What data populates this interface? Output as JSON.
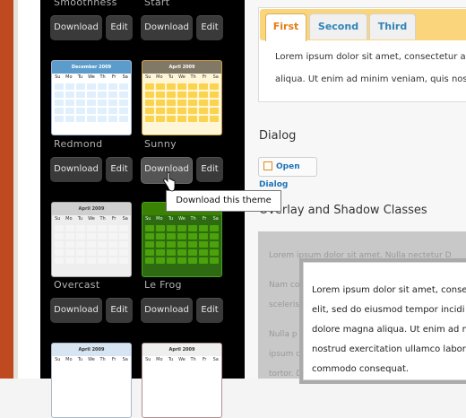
{
  "gallery": {
    "themes": [
      {
        "name": "Smoothness",
        "download_label": "Download",
        "edit_label": "Edit"
      },
      {
        "name": "Start",
        "download_label": "Download",
        "edit_label": "Edit"
      },
      {
        "name": "Redmond",
        "download_label": "Download",
        "edit_label": "Edit",
        "thumb_title": "December 2009"
      },
      {
        "name": "Sunny",
        "download_label": "Download",
        "edit_label": "Edit",
        "thumb_title": "April 2009"
      },
      {
        "name": "Overcast",
        "download_label": "Download",
        "edit_label": "Edit",
        "thumb_title": "April 2009"
      },
      {
        "name": "Le Frog",
        "download_label": "Download",
        "edit_label": "Edit",
        "thumb_title": "April 2009"
      },
      {
        "thumb_title": "April 2009"
      },
      {
        "thumb_title": "April 2009"
      }
    ],
    "tooltip": "Download this theme",
    "colors": {
      "redmond": "#4e8cc7",
      "sunny": "#f8d55c",
      "overcast": "#c9c9c9",
      "le_frog": "#2f8b14"
    }
  },
  "tabs": {
    "items": [
      {
        "label": "First",
        "active": true
      },
      {
        "label": "Second",
        "active": false
      },
      {
        "label": "Third",
        "active": false
      }
    ],
    "content_line1": "Lorem ipsum dolor sit amet, consectetur ad",
    "content_line2": "aliqua. Ut enim ad minim veniam, quis nostr"
  },
  "dialog": {
    "heading": "Dialog",
    "open_label": "Open Dialog"
  },
  "overlay": {
    "heading": "Overlay and Shadow Classes",
    "bg_lines": [
      "Lorem ipsum dolor sit amet. Nulla nectetur D",
      "Nam co",
      "sceleris",
      "Nulla p",
      "ipsum d",
      "tortor. D"
    ],
    "content_lines": [
      "Lorem ipsum dolor sit amet, conse",
      "elit, sed do eiusmod tempor incidi",
      "dolore magna aliqua. Ut enim ad mi",
      "nostrud exercitation ullamco labor",
      "commodo consequat."
    ]
  },
  "week_days": [
    "Su",
    "Mo",
    "Tu",
    "We",
    "Th",
    "Fr",
    "Sa"
  ]
}
